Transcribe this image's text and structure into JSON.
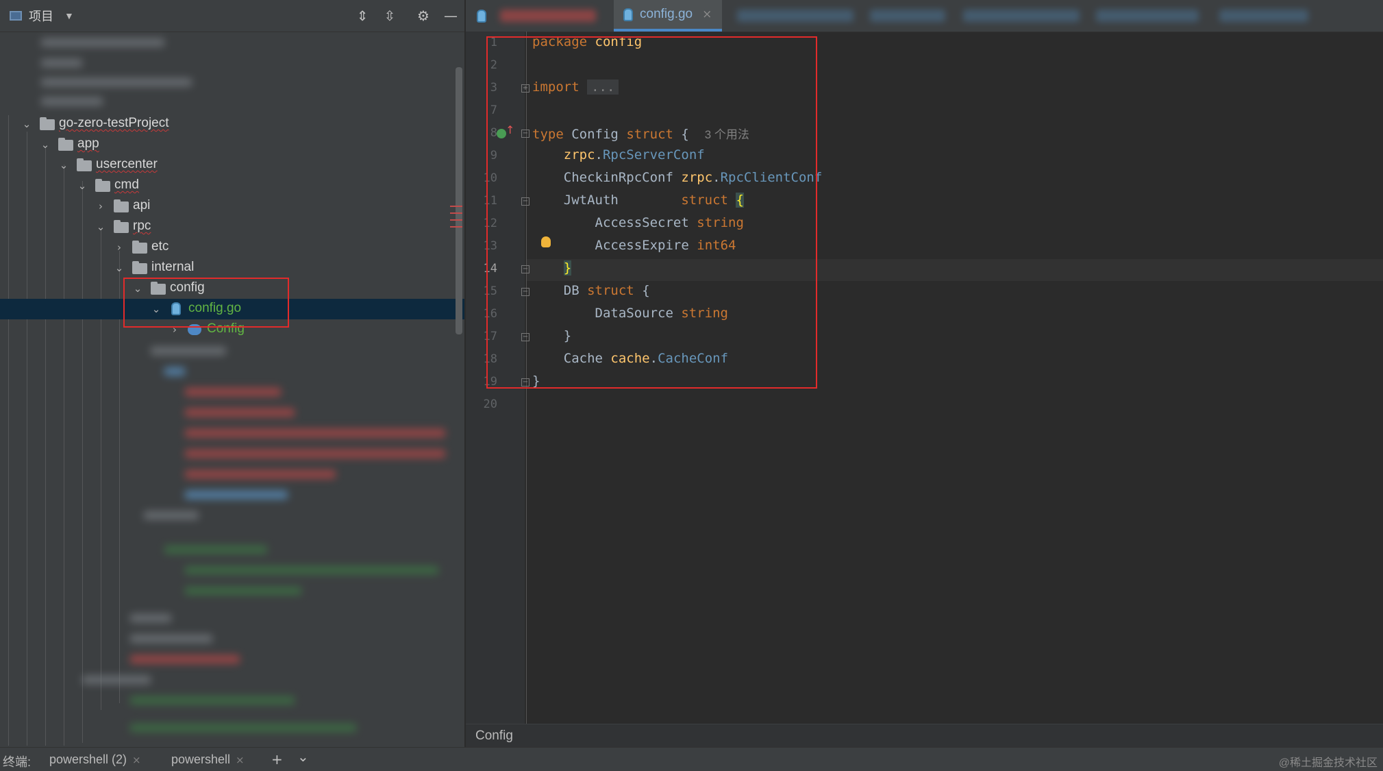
{
  "project_panel": {
    "title": "项目",
    "dropdown_icon": "chevron-down-icon",
    "toolbar_icons": [
      "expand-all-icon",
      "collapse-all-icon",
      "gear-icon",
      "minimize-icon"
    ],
    "tree": {
      "root": "go-zero-testProject",
      "app": "app",
      "usercenter": "usercenter",
      "cmd": "cmd",
      "api": "api",
      "rpc": "rpc",
      "etc": "etc",
      "internal": "internal",
      "config_folder": "config",
      "config_file": "config.go",
      "config_struct": "Config"
    }
  },
  "editor": {
    "active_tab": "config.go",
    "tab_close": "×",
    "code": {
      "l1_kw": "package",
      "l1_name": "config",
      "l3_kw": "import",
      "l3_fold": "...",
      "l8_kw": "type",
      "l8_name": "Config",
      "l8_struct": "struct",
      "l8_brace": "{",
      "l8_hint": "3 个用法",
      "l9_pkg": "zrpc",
      "l9_dot": ".",
      "l9_type": "RpcServerConf",
      "l10_field": "CheckinRpcConf",
      "l10_pkg": "zrpc",
      "l10_dot": ".",
      "l10_type": "RpcClientConf",
      "l11_field": "JwtAuth",
      "l11_struct": "struct",
      "l11_brace": "{",
      "l12_field": "AccessSecret",
      "l12_type": "string",
      "l13_field": "AccessExpire",
      "l13_type": "int64",
      "l14_brace": "}",
      "l15_field": "DB",
      "l15_struct": "struct",
      "l15_brace": "{",
      "l16_field": "DataSource",
      "l16_type": "string",
      "l17_brace": "}",
      "l18_field": "Cache",
      "l18_pkg": "cache",
      "l18_dot": ".",
      "l18_type": "CacheConf",
      "l19_brace": "}"
    },
    "line_numbers": [
      "1",
      "2",
      "3",
      "7",
      "8",
      "9",
      "10",
      "11",
      "12",
      "13",
      "14",
      "15",
      "16",
      "17",
      "18",
      "19",
      "20"
    ],
    "current_line": "14",
    "breadcrumb": "Config"
  },
  "bottom_bar": {
    "terminal_label": "终端:",
    "tab1": "powershell (2)",
    "tab2": "powershell",
    "close": "×",
    "add": "+",
    "more": "⌄",
    "watermark": "@稀土掘金技术社区"
  },
  "colors": {
    "highlight_box": "#e22b2b",
    "keyword": "#cc7832",
    "package": "#ffc66d",
    "type_ref": "#6897bb",
    "selection": "#0d293e"
  }
}
